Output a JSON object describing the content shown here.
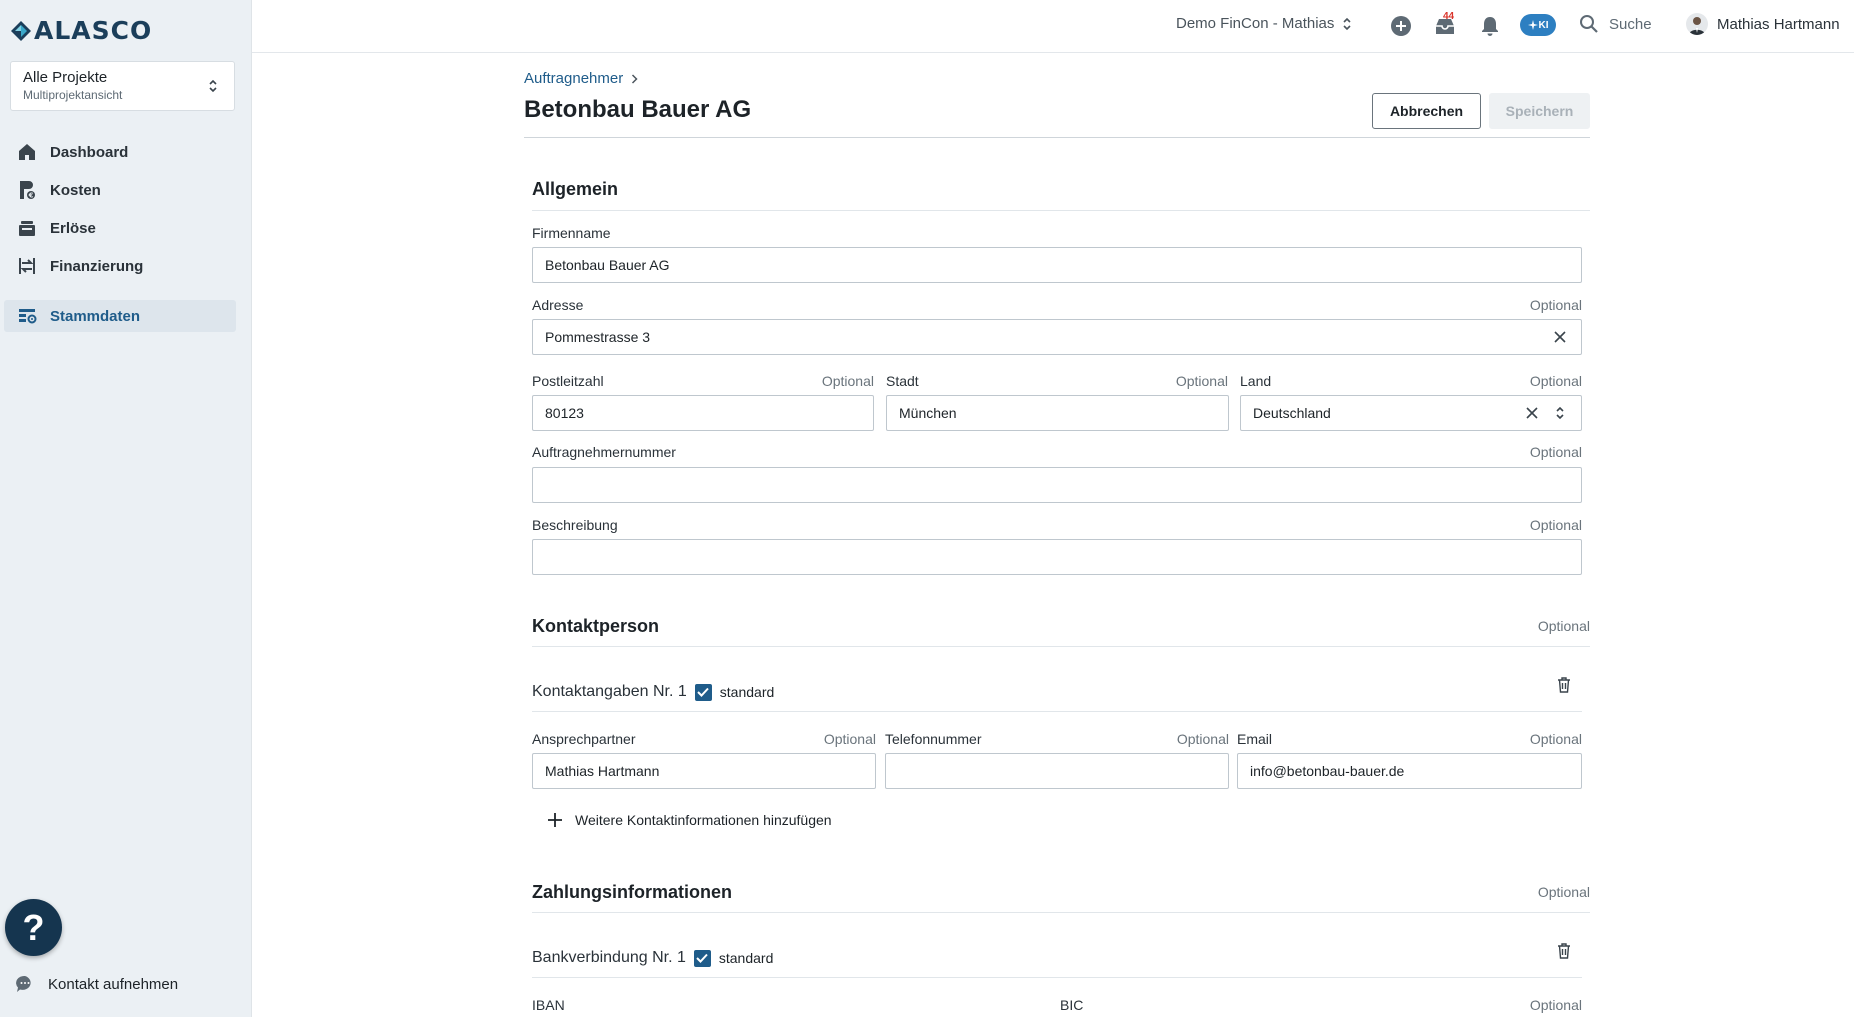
{
  "sidebar": {
    "logo_text": "ALASCO",
    "project": {
      "title": "Alle Projekte",
      "subtitle": "Multiprojektansicht"
    },
    "nav": [
      {
        "label": "Dashboard",
        "icon": "home-icon"
      },
      {
        "label": "Kosten",
        "icon": "cost-icon"
      },
      {
        "label": "Erlöse",
        "icon": "revenue-icon"
      },
      {
        "label": "Finanzierung",
        "icon": "financing-icon"
      },
      {
        "label": "Stammdaten",
        "icon": "master-data-icon",
        "active": true
      }
    ],
    "help_label": "?",
    "contact_label": "Kontakt aufnehmen"
  },
  "topbar": {
    "org": "Demo FinCon - Mathias",
    "inbox_count": "44",
    "ki_label": "KI",
    "search_label": "Suche",
    "user_name": "Mathias Hartmann"
  },
  "page": {
    "breadcrumb": "Auftragnehmer",
    "title": "Betonbau Bauer AG",
    "cancel_label": "Abbrechen",
    "save_label": "Speichern"
  },
  "optional_label": "Optional",
  "general": {
    "title": "Allgemein",
    "company_label": "Firmenname",
    "company_value": "Betonbau Bauer AG",
    "address_label": "Adresse",
    "address_value": "Pommestrasse 3",
    "zip_label": "Postleitzahl",
    "zip_value": "80123",
    "city_label": "Stadt",
    "city_value": "München",
    "country_label": "Land",
    "country_value": "Deutschland",
    "contractor_no_label": "Auftragnehmernummer",
    "contractor_no_value": "",
    "description_label": "Beschreibung",
    "description_value": ""
  },
  "contact": {
    "title": "Kontaktperson",
    "entry_title": "Kontaktangaben Nr. 1",
    "standard_label": "standard",
    "person_label": "Ansprechpartner",
    "person_value": "Mathias Hartmann",
    "phone_label": "Telefonnummer",
    "phone_value": "",
    "email_label": "Email",
    "email_value": "info@betonbau-bauer.de",
    "add_label": "Weitere Kontaktinformationen hinzufügen"
  },
  "payment": {
    "title": "Zahlungsinformationen",
    "entry_title": "Bankverbindung Nr. 1",
    "standard_label": "standard",
    "iban_label": "IBAN",
    "bic_label": "BIC"
  },
  "colors": {
    "accent": "#1f5c8a",
    "navy": "#15354f",
    "sidebar_bg": "#ebf0f4",
    "ki_blue": "#2d7fc1",
    "badge_red": "#d9342b"
  }
}
